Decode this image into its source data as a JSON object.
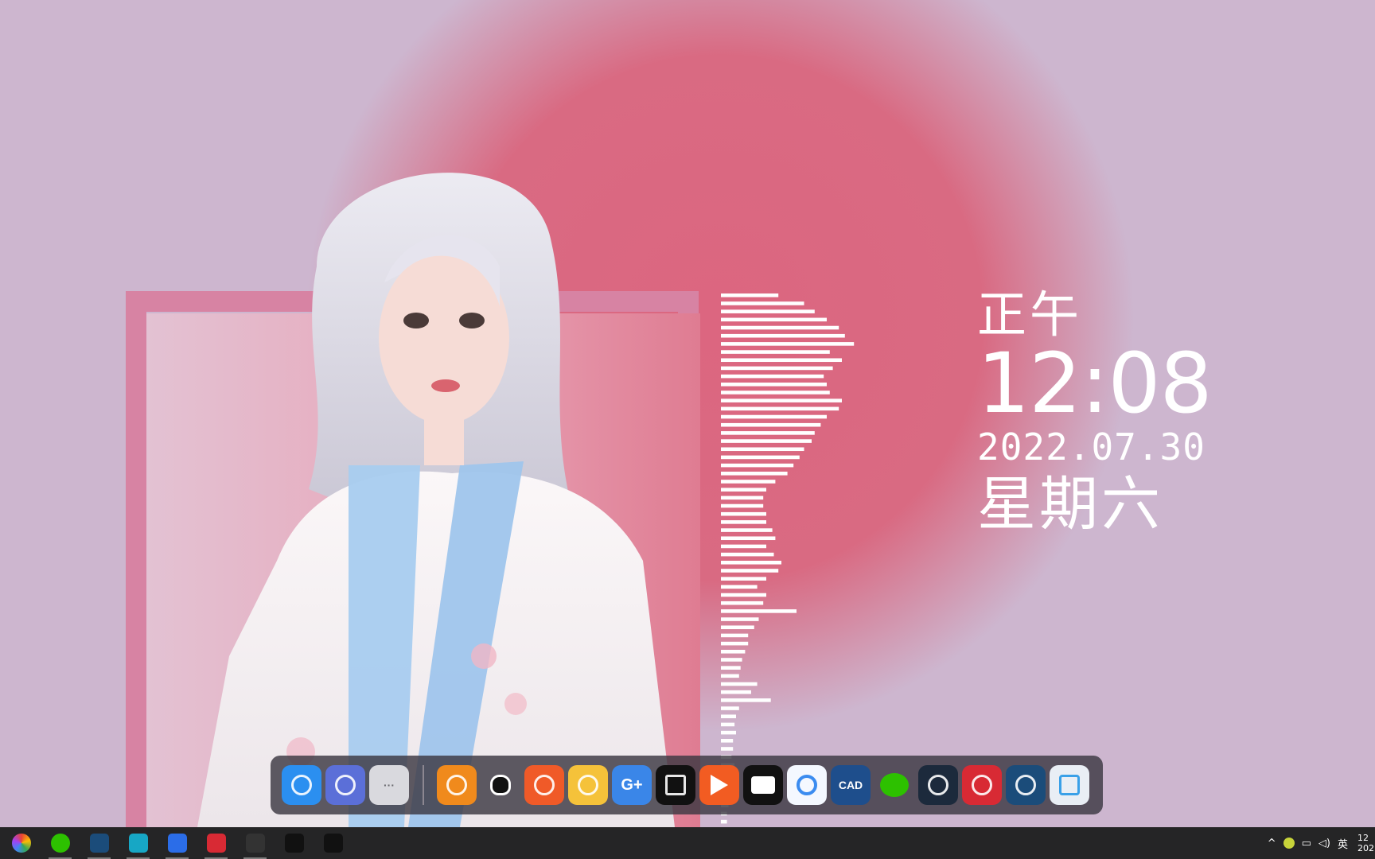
{
  "desktop": {
    "clock_widget": {
      "period": "正午",
      "time": "12:08",
      "date": "2022.07.30",
      "weekday": "星期六"
    },
    "equalizer_levels": [
      0.38,
      0.55,
      0.62,
      0.7,
      0.78,
      0.82,
      0.88,
      0.72,
      0.8,
      0.74,
      0.68,
      0.7,
      0.72,
      0.8,
      0.78,
      0.7,
      0.66,
      0.62,
      0.6,
      0.55,
      0.52,
      0.48,
      0.44,
      0.36,
      0.3,
      0.28,
      0.28,
      0.3,
      0.3,
      0.34,
      0.36,
      0.3,
      0.35,
      0.4,
      0.38,
      0.3,
      0.24,
      0.3,
      0.28,
      0.5,
      0.25,
      0.22,
      0.18,
      0.18,
      0.16,
      0.14,
      0.13,
      0.12,
      0.24,
      0.2,
      0.33,
      0.12,
      0.1,
      0.09,
      0.1,
      0.08,
      0.08,
      0.07,
      0.09,
      0.06,
      0.06,
      0.05,
      0.05,
      0.05,
      0.04,
      0.04
    ],
    "accent_colors": {
      "glow": "#dc6680",
      "background": "#cdb6cf",
      "frame": "#d783a3"
    }
  },
  "dock": {
    "items": [
      {
        "name": "finder",
        "icon": "finder-icon",
        "color": "#2b8ff0"
      },
      {
        "name": "launchpad",
        "icon": "rocket-icon",
        "color": "#5b6fd8"
      },
      {
        "name": "more",
        "icon": "more-dots-icon",
        "color": "#d9d9de",
        "glyph": "···"
      },
      {
        "name": "app-power",
        "icon": "power-ring-icon",
        "color": "#f08a1c"
      },
      {
        "name": "qq",
        "icon": "qq-penguin-icon",
        "color": "transparent"
      },
      {
        "name": "origin",
        "icon": "origin-icon",
        "color": "#f05a28"
      },
      {
        "name": "raccoon",
        "icon": "raccoon-icon",
        "color": "#f5c23a"
      },
      {
        "name": "gplus",
        "icon": "gplus-icon",
        "color": "#3a86e8",
        "glyph": "G+"
      },
      {
        "name": "capcut",
        "icon": "capcut-icon",
        "color": "#111111"
      },
      {
        "name": "video-player",
        "icon": "play-icon",
        "color": "#f25c22"
      },
      {
        "name": "hexagon",
        "icon": "hexagon-icon",
        "color": "#111111"
      },
      {
        "name": "baidu-netdisk",
        "icon": "cloud-icon",
        "color": "#f4f8ff"
      },
      {
        "name": "cad",
        "icon": "cad-icon",
        "color": "#1e4e8c",
        "glyph": "CAD"
      },
      {
        "name": "wechat",
        "icon": "wechat-icon",
        "color": "transparent"
      },
      {
        "name": "green-ring",
        "icon": "ring-icon",
        "color": "#1c2a3c"
      },
      {
        "name": "netease-music",
        "icon": "music-icon",
        "color": "#d82a34"
      },
      {
        "name": "steam",
        "icon": "steam-icon",
        "color": "#1b4c7a"
      },
      {
        "name": "recycle-bin",
        "icon": "recycle-bin-icon",
        "color": "#e9eef5"
      }
    ]
  },
  "taskbar": {
    "items": [
      {
        "name": "start",
        "icon": "color-wheel-icon",
        "color": "#f4b400",
        "open": false
      },
      {
        "name": "wechat",
        "icon": "wechat-icon",
        "color": "#2dc100",
        "open": true
      },
      {
        "name": "steam",
        "icon": "steam-icon",
        "color": "#1b4c7a",
        "open": true
      },
      {
        "name": "ring-app",
        "icon": "ring-icon",
        "color": "#17a7c5",
        "open": true
      },
      {
        "name": "capture-app",
        "icon": "capture-icon",
        "color": "#2b6de8",
        "open": true
      },
      {
        "name": "netease-music",
        "icon": "music-icon",
        "color": "#d82a34",
        "open": true
      },
      {
        "name": "video-recorder",
        "icon": "recorder-icon",
        "color": "#333333",
        "open": true
      },
      {
        "name": "capcut",
        "icon": "capcut-icon",
        "color": "#111111",
        "open": false
      },
      {
        "name": "vector-app",
        "icon": "vector-icon",
        "color": "#111111",
        "open": false
      }
    ],
    "tray": {
      "chevron": "^",
      "ime": "英",
      "clock_top": "12",
      "clock_bottom": "202"
    }
  }
}
